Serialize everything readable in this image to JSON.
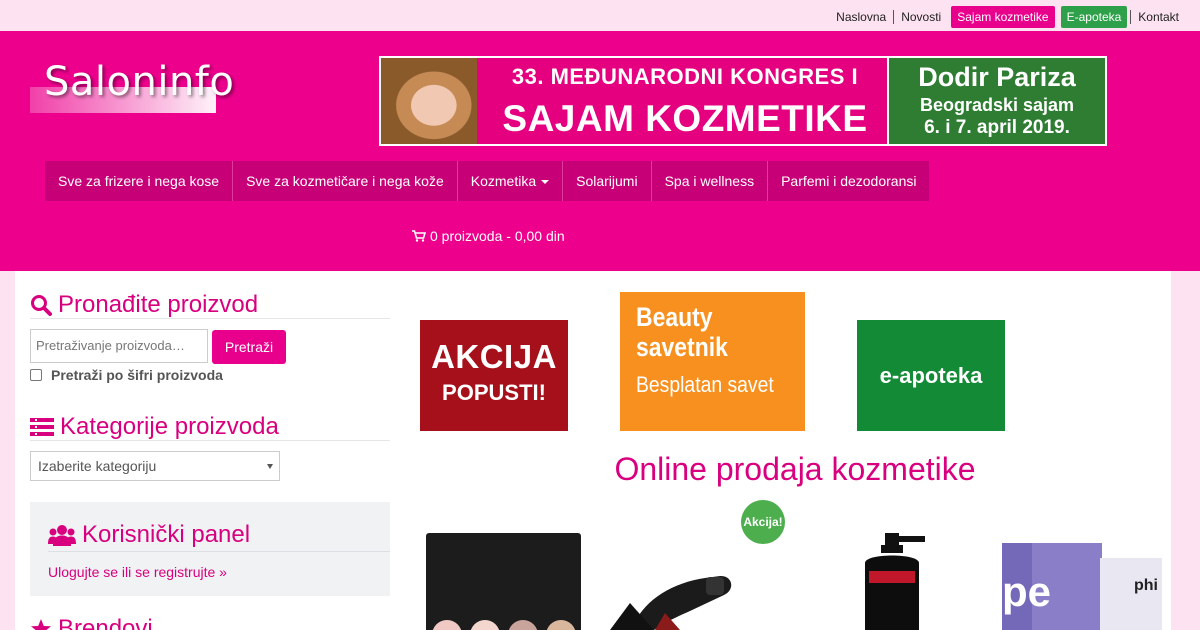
{
  "topbar": {
    "links": [
      "Naslovna",
      "Novosti",
      "Sajam kozmetike",
      "E-apoteka",
      "Kontakt"
    ]
  },
  "header": {
    "logo_text": "Saloninfo",
    "banner": {
      "line1": "33. MEĐUNARODNI KONGRES I",
      "line2": "SAJAM KOZMETIKE",
      "right_title": "Dodir Pariza",
      "right_line2": "Beogradski sajam",
      "right_line3": "6. i 7. april 2019."
    },
    "nav": [
      "Sve za frizere i nega kose",
      "Sve za kozmetičare i nega kože",
      "Kozmetika",
      "Solarijumi",
      "Spa i wellness",
      "Parfemi i dezodoransi"
    ],
    "cart_text": "0 proizvoda - 0,00 din"
  },
  "sidebar": {
    "search_heading": "Pronađite proizvod",
    "search_placeholder": "Pretraživanje proizvoda…",
    "search_button": "Pretraži",
    "sku_checkbox_label": "Pretraži po šifri proizvoda",
    "categories_heading": "Kategorije proizvoda",
    "categories_select": "Izaberite kategoriju",
    "user_panel_heading": "Korisnički panel",
    "user_panel_link": "Ulogujte se ili se registrujte »",
    "brands_heading": "Brendovi"
  },
  "promos": {
    "akcija_line1": "AKCIJA",
    "akcija_line2": "POPUSTI!",
    "beauty_line1": "Beauty",
    "beauty_line2": "savetnik",
    "beauty_line3": "Besplatan savet",
    "apoteka": "e-apoteka"
  },
  "main": {
    "headline": "Online prodaja kozmetike",
    "sale_badge": "Akcija!"
  },
  "colors": {
    "brand_pink": "#ec008c",
    "nav_pink": "#c80078",
    "heading_pink": "#d8007f",
    "green": "#2ea049"
  }
}
